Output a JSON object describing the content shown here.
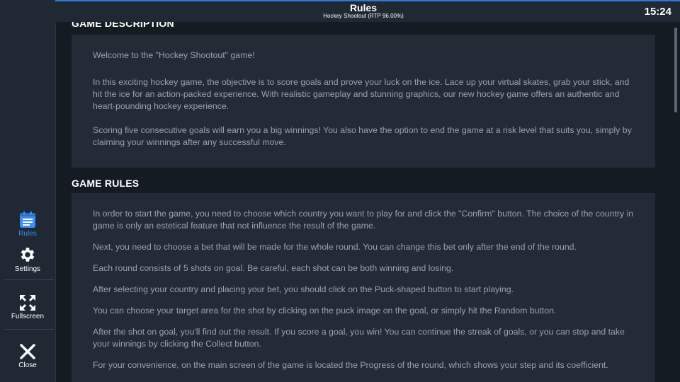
{
  "sidebar": {
    "items": [
      {
        "label": "Rules",
        "icon": "rules-icon",
        "active": true
      },
      {
        "label": "Settings",
        "icon": "gear-icon",
        "active": false
      },
      {
        "label": "Fullscreen",
        "icon": "fullscreen-icon",
        "active": false
      },
      {
        "label": "Close",
        "icon": "close-icon",
        "active": false
      }
    ]
  },
  "header": {
    "title": "Rules",
    "subtitle": "Hockey Shootout (RTP 96.00%)",
    "clock": "15:24"
  },
  "sections": {
    "description": {
      "title": "GAME DESCRIPTION",
      "paragraphs": [
        "Welcome to the \"Hockey Shootout\" game!",
        "In this exciting hockey game, the objective is to score goals and prove your luck on the ice. Lace up your virtual skates, grab your stick, and hit the ice for an action-packed experience. With realistic gameplay and stunning graphics, our new hockey game offers an authentic and heart-pounding hockey experience.",
        "Scoring five consecutive goals will earn you a big winnings! You also have the option to end the game at a risk level that suits you, simply by claiming your winnings after any successful move."
      ]
    },
    "rules": {
      "title": "GAME RULES",
      "paragraphs": [
        "In order to start the game, you need to choose which country you want to play for and click the \"Confirm\" button. The choice of the country in game is only an estetical feature that not influence the result of the game.",
        "Next, you need to choose a bet that will be made for the whole round. You can change this bet only after the end of the round.",
        "Each round consists of 5 shots on goal. Be careful, each shot can be both winning and losing.",
        "After selecting your country and placing your bet, you should click on the Puck-shaped button to start playing.",
        "You can choose your target area for the shot by clicking on the puck image on the goal, or simply hit the Random button.",
        "After the shot on goal, you'll find out the result. If you score a goal, you win! You can continue the streak of goals, or you can stop and take your winnings by clicking the Collect button.",
        "For your convenience, on the main screen of the game is located the Progress of the round, which shows your step and its coefficient."
      ]
    }
  },
  "colors": {
    "accent": "#3a8ef6",
    "panel": "#222b36",
    "background": "#151b23"
  }
}
